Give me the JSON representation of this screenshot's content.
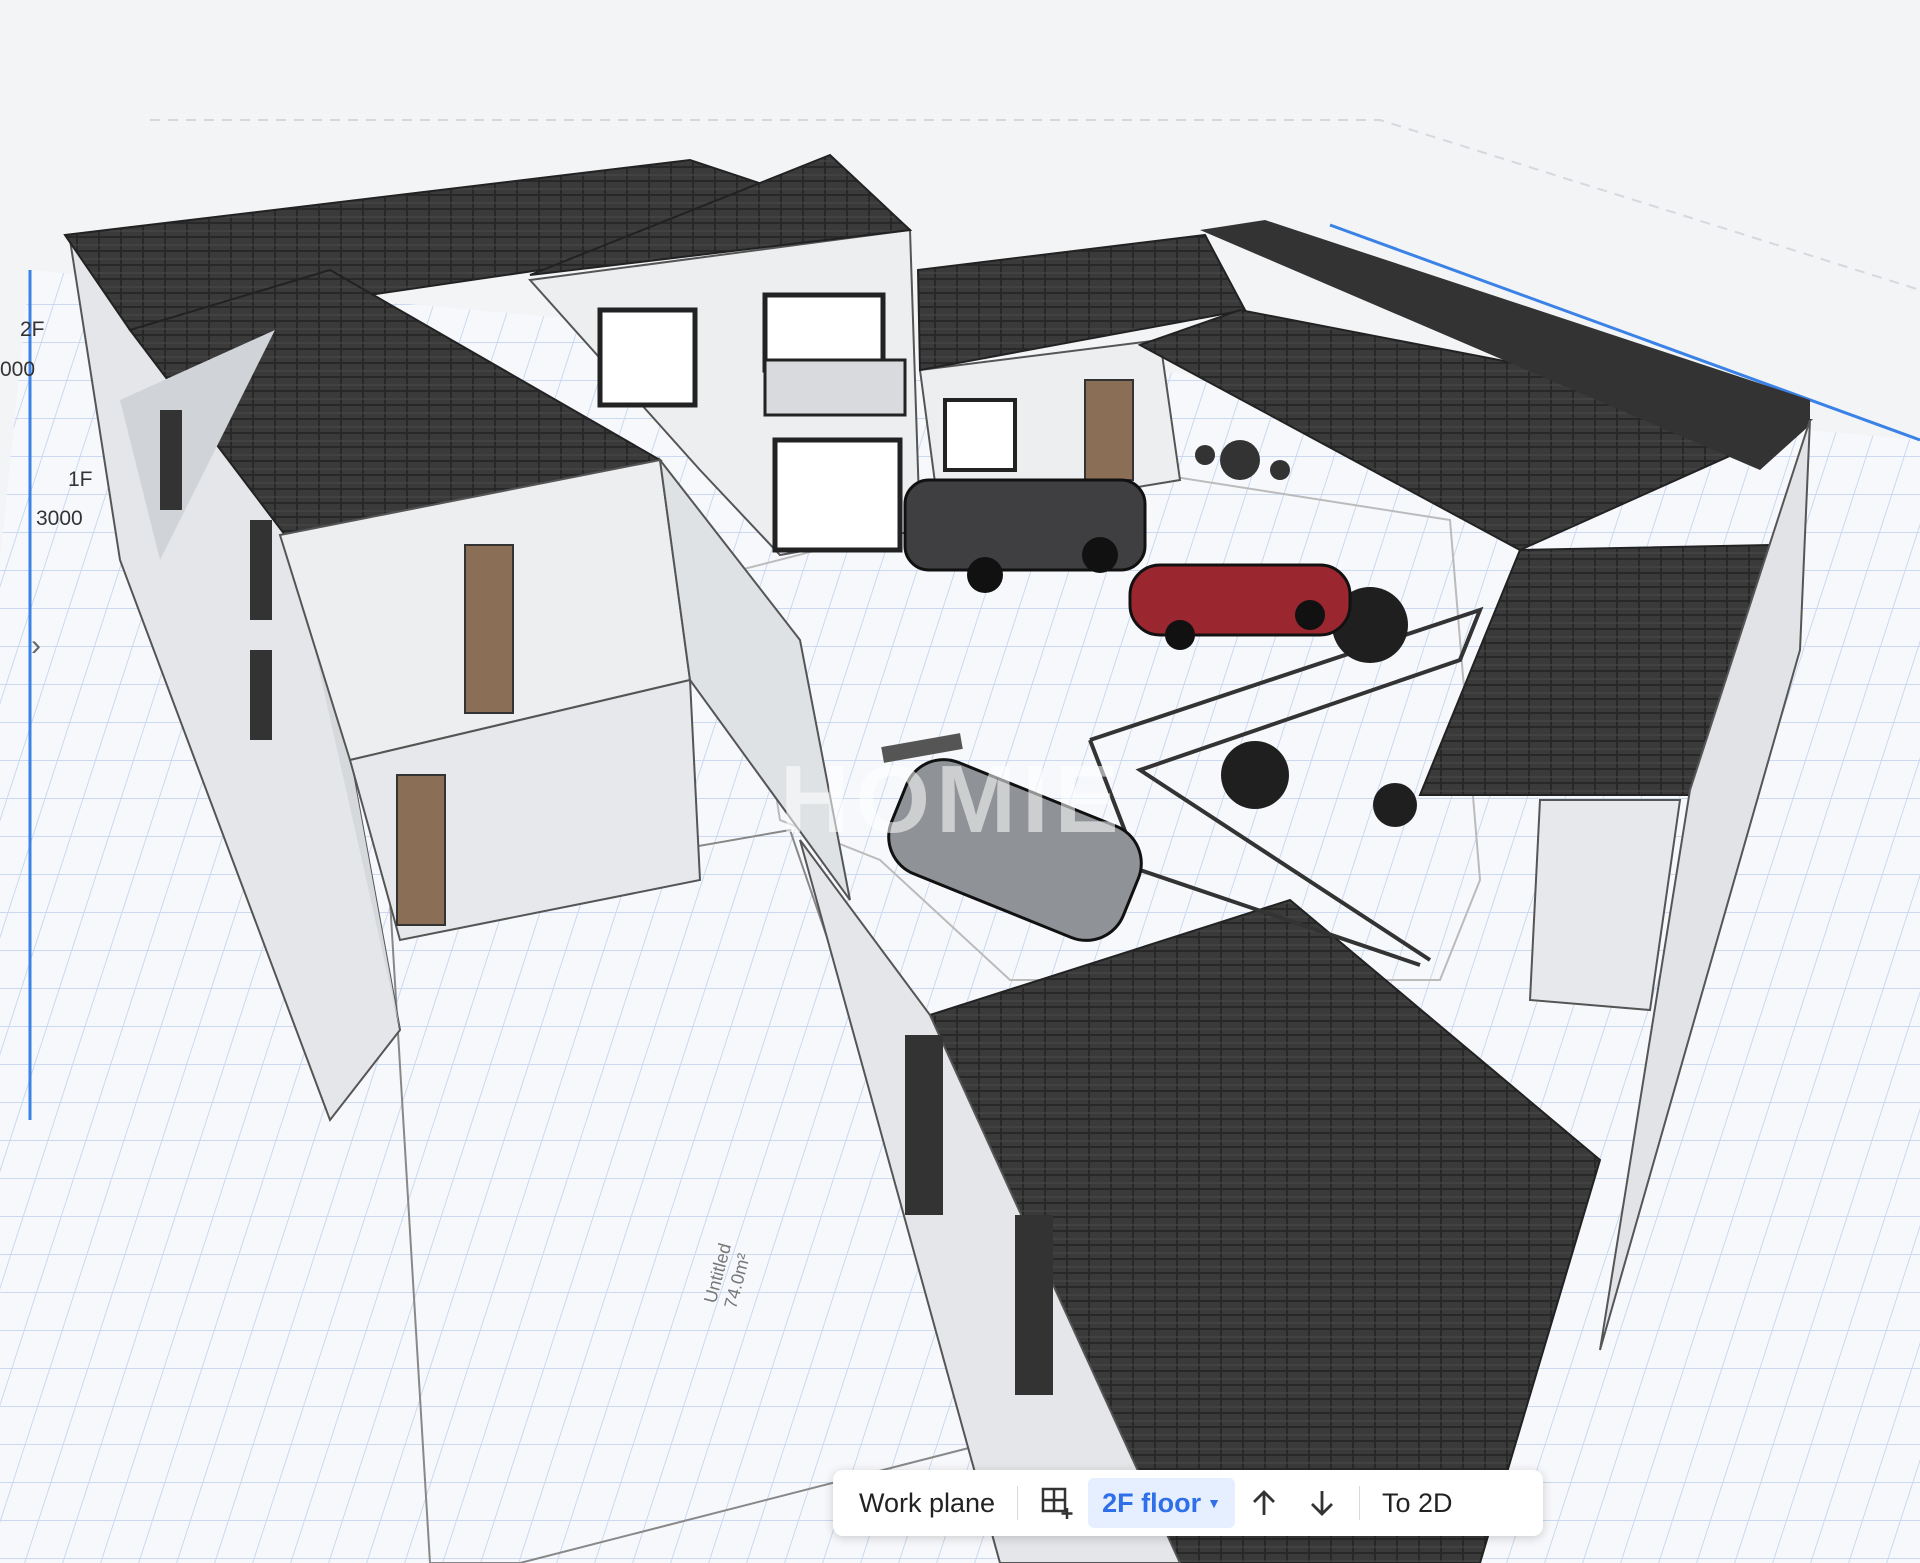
{
  "side_labels": {
    "floor_2": "2F",
    "floor_2_height": "000",
    "floor_1": "1F",
    "floor_1_height": "3000"
  },
  "watermark": "HOMIE",
  "room_label": {
    "name": "Untitled",
    "area": "74.0m²"
  },
  "toolbar": {
    "work_plane": "Work plane",
    "floor_select": "2F floor",
    "to_2d": "To 2D"
  },
  "icons": {
    "expand": "chevron-right-icon",
    "add_grid": "grid-add-icon",
    "floor_up": "arrow-up-icon",
    "floor_down": "arrow-down-icon",
    "dropdown": "caret-down-icon"
  },
  "colors": {
    "accent": "#2f6fe8",
    "roof": "#3a3a3a",
    "wall": "#eceef0",
    "grid_line": "#c9d8ef",
    "floor_edge": "#3b82e6"
  }
}
